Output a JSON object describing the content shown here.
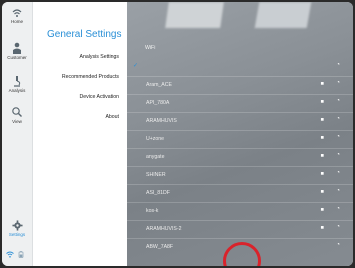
{
  "nav": {
    "items": [
      {
        "label": "Home",
        "icon": "wifi-arrows-icon"
      },
      {
        "label": "Customer",
        "icon": "person-icon"
      },
      {
        "label": "Analysis",
        "icon": "microscope-icon"
      },
      {
        "label": "View",
        "icon": "magnifier-icon"
      },
      {
        "label": "Settings",
        "icon": "gear-icon"
      }
    ],
    "bottom_icons": [
      "wifi-status-icon",
      "battery-icon"
    ]
  },
  "menu": {
    "title": "General Settings",
    "items": [
      "Analysis Settings",
      "Recommended Products",
      "Device Activation",
      "About"
    ]
  },
  "wifi": {
    "header": "WiFi",
    "networks": [
      {
        "name": "",
        "connected": true,
        "locked": false
      },
      {
        "name": "Aram_ACE",
        "connected": false,
        "locked": true
      },
      {
        "name": "API_780A",
        "connected": false,
        "locked": true
      },
      {
        "name": "ARAMHUVIS",
        "connected": false,
        "locked": true
      },
      {
        "name": "U+zone",
        "connected": false,
        "locked": true
      },
      {
        "name": "anygate",
        "connected": false,
        "locked": true
      },
      {
        "name": "SHINER",
        "connected": false,
        "locked": true
      },
      {
        "name": "ASI_81DF",
        "connected": false,
        "locked": true
      },
      {
        "name": "kos-k",
        "connected": false,
        "locked": true
      },
      {
        "name": "ARAMHUVIS-2",
        "connected": false,
        "locked": true
      },
      {
        "name": "ABW_7A8F",
        "connected": false,
        "locked": false
      }
    ]
  },
  "colors": {
    "accent": "#2a8fd6",
    "highlight": "#d9232b"
  }
}
